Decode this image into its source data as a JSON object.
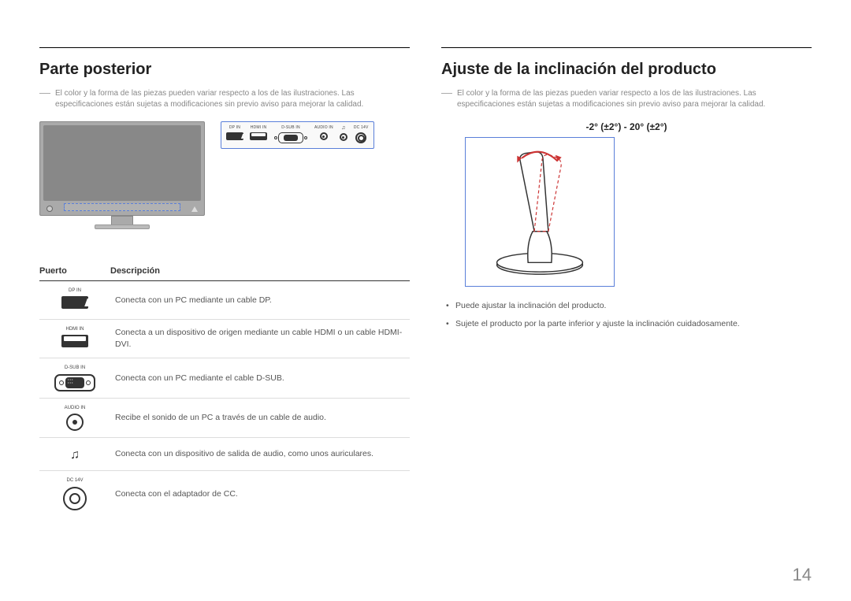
{
  "page_number": "14",
  "left": {
    "heading": "Parte posterior",
    "note": "El color y la forma de las piezas pueden variar respecto a los de las ilustraciones. Las especificaciones están sujetas a modificaciones sin previo aviso para mejorar la calidad.",
    "port_panel": {
      "dp": "DP IN",
      "hdmi": "HDMI IN",
      "dsub": "D-SUB IN",
      "audio": "AUDIO IN",
      "head": "♫",
      "dc": "DC 14V"
    },
    "table": {
      "col_port": "Puerto",
      "col_desc": "Descripción",
      "rows": [
        {
          "label": "DP IN",
          "desc": "Conecta con un PC mediante un cable DP."
        },
        {
          "label": "HDMI IN",
          "desc": "Conecta a un dispositivo de origen mediante un cable HDMI o un cable HDMI-DVI."
        },
        {
          "label": "D-SUB IN",
          "desc": "Conecta con un PC mediante el cable D-SUB."
        },
        {
          "label": "AUDIO IN",
          "desc": "Recibe el sonido de un PC a través de un cable de audio."
        },
        {
          "label": "",
          "desc": "Conecta con un dispositivo de salida de audio, como unos auriculares."
        },
        {
          "label": "DC 14V",
          "desc": "Conecta con el adaptador de CC."
        }
      ]
    }
  },
  "right": {
    "heading": "Ajuste de la inclinación del producto",
    "note": "El color y la forma de las piezas pueden variar respecto a los de las ilustraciones. Las especificaciones están sujetas a modificaciones sin previo aviso para mejorar la calidad.",
    "tilt_range": "-2° (±2°) - 20° (±2°)",
    "bullets": [
      "Puede ajustar la inclinación del producto.",
      "Sujete el producto por la parte inferior y ajuste la inclinación cuidadosamente."
    ]
  }
}
